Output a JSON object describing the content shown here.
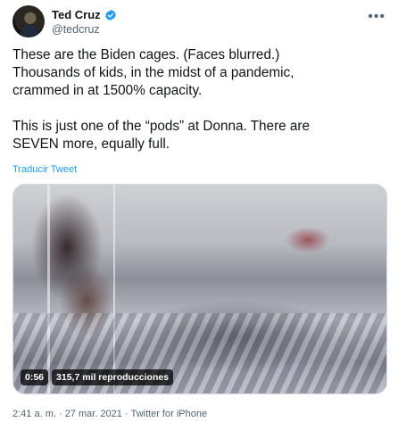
{
  "tweet": {
    "author_name": "Ted Cruz",
    "author_handle": "@tedcruz",
    "text_line1": "These are the Biden cages. (Faces blurred.)",
    "text_line2": "Thousands of kids, in the midst of a pandemic,",
    "text_line3": "crammed in at 1500% capacity.",
    "text_line4": "This is just one of the “pods” at Donna. There are",
    "text_line5": "SEVEN more, equally full.",
    "translate_label": "Traducir Tweet",
    "video_duration": "0:56",
    "video_views": "315,7 mil reproducciones",
    "timestamp": "2:41 a. m. · 27 mar. 2021 · Twitter for iPhone"
  },
  "icons": {
    "verified": "verified-badge-icon",
    "more": "more-options-icon"
  },
  "colors": {
    "link": "#1d9bf0",
    "secondary_text": "#536471",
    "primary_text": "#0f1419"
  }
}
